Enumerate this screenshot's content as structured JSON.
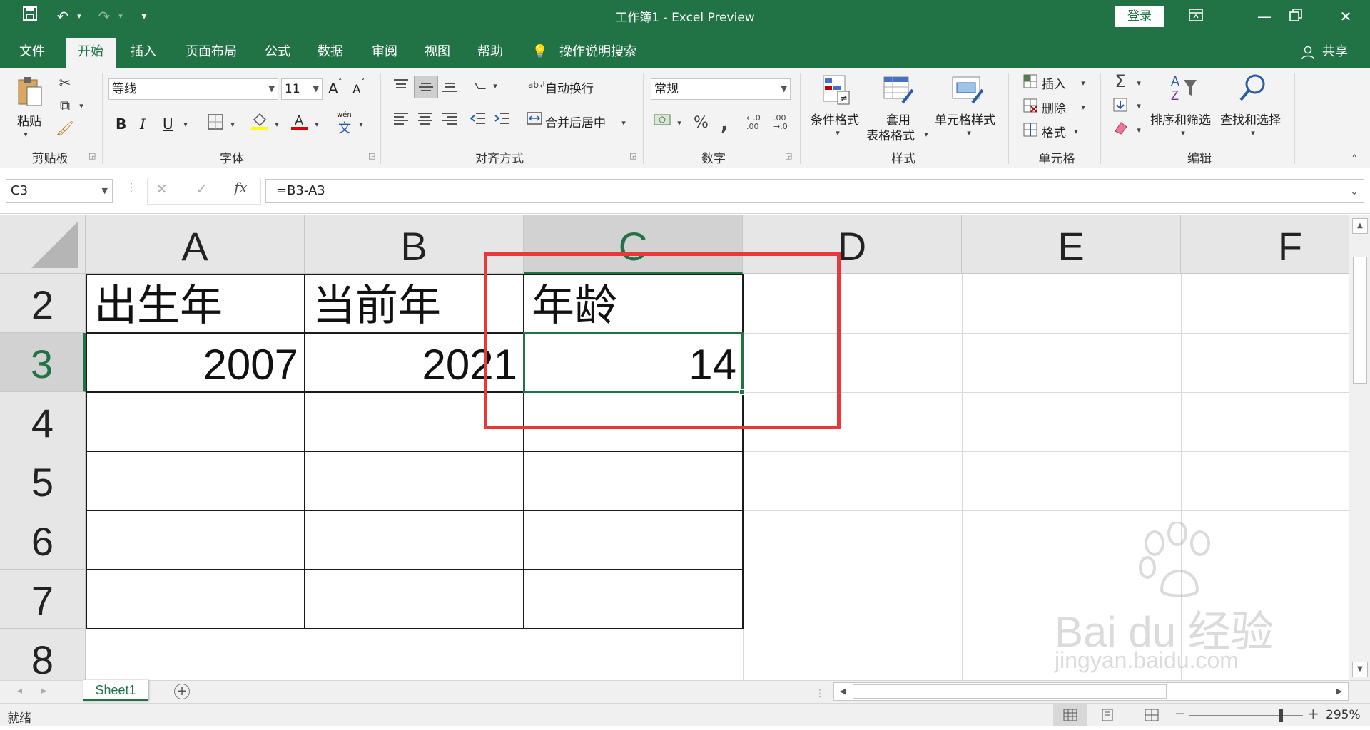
{
  "window": {
    "title": "工作簿1  -  Excel Preview",
    "login_label": "登录",
    "share_label": "共享"
  },
  "tabs": [
    "文件",
    "开始",
    "插入",
    "页面布局",
    "公式",
    "数据",
    "审阅",
    "视图",
    "帮助"
  ],
  "active_tab": "开始",
  "tell_me": "操作说明搜索",
  "ribbon": {
    "clipboard": {
      "paste": "粘贴",
      "label": "剪贴板"
    },
    "font": {
      "name": "等线",
      "size": "11",
      "label": "字体",
      "bold": "B",
      "italic": "I",
      "underline": "U",
      "grow": "A",
      "shrink": "A",
      "wen": "wén"
    },
    "alignment": {
      "wrap": "自动换行",
      "merge": "合并后居中",
      "label": "对齐方式"
    },
    "number": {
      "format": "常规",
      "percent": "%",
      "comma": ",",
      "label": "数字"
    },
    "styles": {
      "conditional": "条件格式",
      "table_line1": "套用",
      "table_line2": "表格格式",
      "cell_styles": "单元格样式",
      "label": "样式"
    },
    "cells": {
      "insert": "插入",
      "delete": "删除",
      "format": "格式",
      "label": "单元格"
    },
    "editing": {
      "sort": "排序和筛选",
      "find": "查找和选择",
      "label": "编辑"
    }
  },
  "formula_bar": {
    "name_box": "C3",
    "formula": "=B3-A3"
  },
  "sheet": {
    "columns": [
      "A",
      "B",
      "C",
      "D",
      "E",
      "F"
    ],
    "selected_column": "C",
    "rows": [
      "2",
      "3",
      "4",
      "5",
      "6",
      "7",
      "8"
    ],
    "selected_row": "3",
    "cells": {
      "A2": "出生年",
      "B2": "当前年",
      "C2": "年龄",
      "A3": "2007",
      "B3": "2021",
      "C3": "14"
    },
    "active_cell": "C3",
    "highlight_color": "#e8393a"
  },
  "sheet_tabs": [
    "Sheet1"
  ],
  "status": {
    "ready": "就绪",
    "zoom": "295%"
  },
  "watermark": {
    "brand": "Bai du 经验",
    "url": "jingyan.baidu.com"
  },
  "colors": {
    "excel_green": "#217346"
  }
}
